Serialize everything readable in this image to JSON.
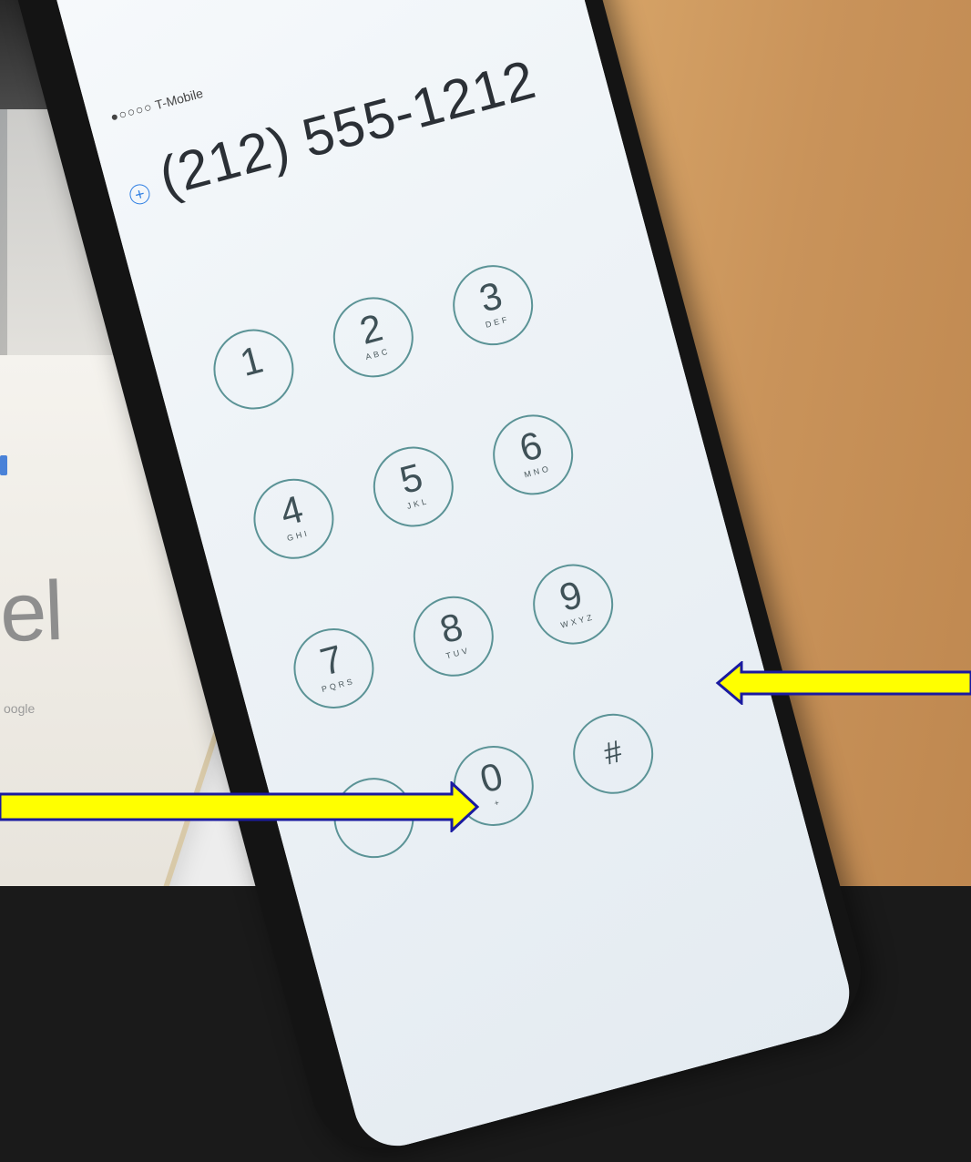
{
  "status_bar": {
    "signal": "●○○○○",
    "carrier": "T-Mobile"
  },
  "dialer": {
    "number": "(212) 555-1212",
    "add_contact_icon": "plus-circle-icon"
  },
  "keypad": [
    {
      "digit": "1",
      "letters": ""
    },
    {
      "digit": "2",
      "letters": "ABC"
    },
    {
      "digit": "3",
      "letters": "DEF"
    },
    {
      "digit": "4",
      "letters": "GHI"
    },
    {
      "digit": "5",
      "letters": "JKL"
    },
    {
      "digit": "6",
      "letters": "MNO"
    },
    {
      "digit": "7",
      "letters": "PQRS"
    },
    {
      "digit": "8",
      "letters": "TUV"
    },
    {
      "digit": "9",
      "letters": "WXYZ"
    },
    {
      "digit": "*",
      "letters": ""
    },
    {
      "digit": "0",
      "letters": "+"
    },
    {
      "digit": "#",
      "letters": ""
    }
  ],
  "background_box": {
    "brand_fragment": "el",
    "subtext": "oogle"
  },
  "colors": {
    "arrow_fill": "#ffff00",
    "arrow_outline": "#1a1aa0",
    "key_ring": "#5b9396",
    "accent": "#2f7fe3"
  }
}
